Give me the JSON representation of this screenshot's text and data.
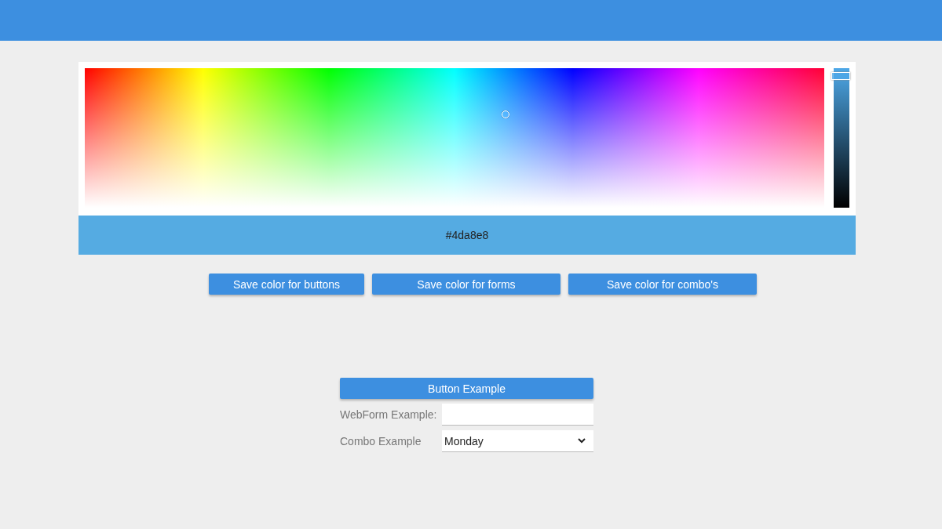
{
  "color_picker": {
    "brightness_slider": {
      "level": 0.95
    },
    "hex_value": "#4da8e8"
  },
  "save_buttons": [
    "Save color for buttons",
    "Save color for forms",
    "Save color for combo's"
  ],
  "examples": {
    "button": "Button Example",
    "webform_label": "WebForm Example:",
    "combo_label": "Combo Example",
    "combo_value": "Monday"
  }
}
